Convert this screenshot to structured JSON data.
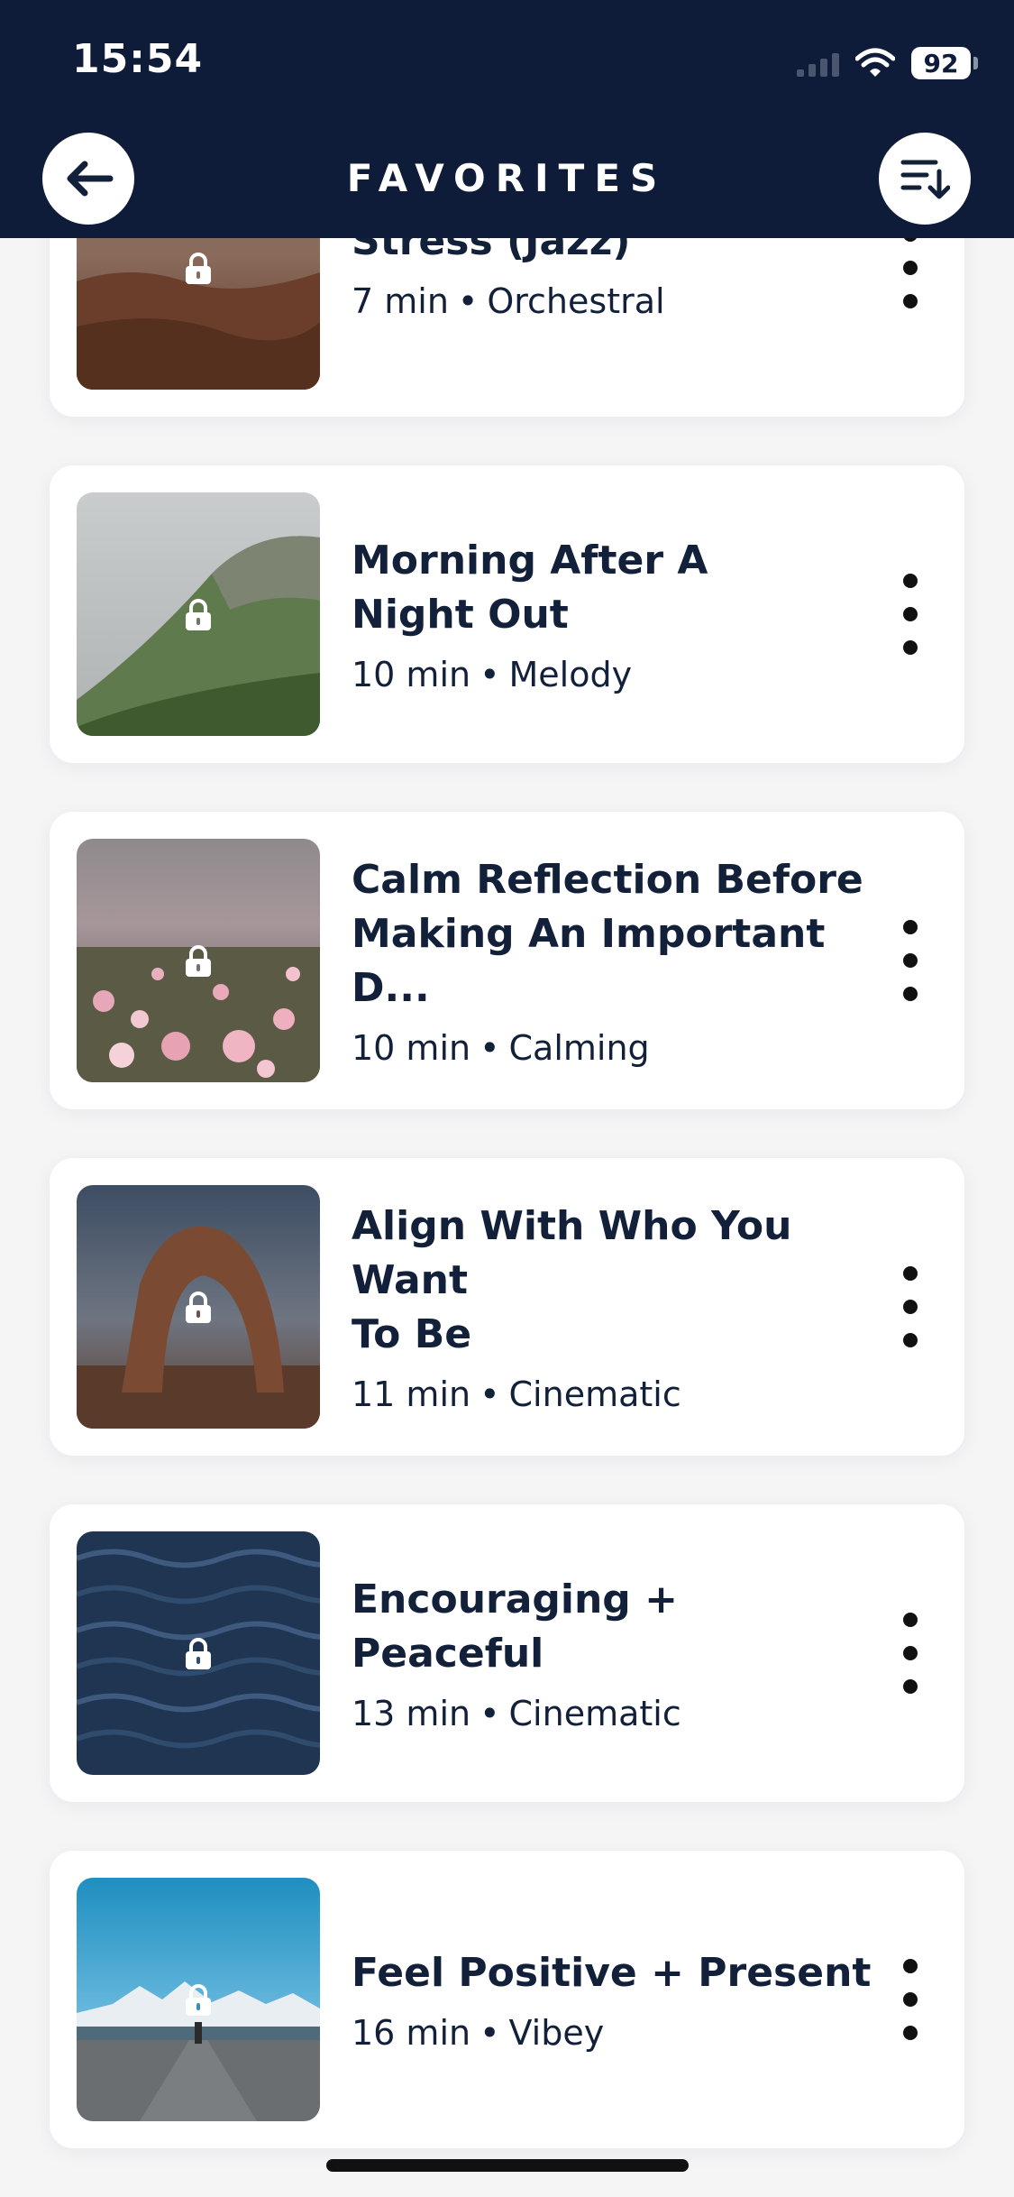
{
  "status_bar": {
    "time": "15:54",
    "battery": "92"
  },
  "header": {
    "title": "FAVORITES"
  },
  "items": [
    {
      "title": "Stress (Jazz)",
      "duration": "7 min",
      "genre": "Orchestral"
    },
    {
      "title": "Morning After A\nNight Out",
      "duration": "10 min",
      "genre": "Melody"
    },
    {
      "title": "Calm Reflection Before\nMaking An Important D...",
      "duration": "10 min",
      "genre": "Calming"
    },
    {
      "title": "Align With Who You Want\nTo Be",
      "duration": "11 min",
      "genre": "Cinematic"
    },
    {
      "title": "Encouraging + Peaceful",
      "duration": "13 min",
      "genre": "Cinematic"
    },
    {
      "title": "Feel Positive + Present",
      "duration": "16 min",
      "genre": "Vibey"
    }
  ],
  "icons": {
    "back": "arrow-left-icon",
    "sort": "sort-descending-icon",
    "lock": "lock-icon",
    "more": "more-vertical-icon"
  },
  "colors": {
    "header_bg": "#0e1c39",
    "text": "#12203a",
    "card_bg": "#ffffff"
  }
}
